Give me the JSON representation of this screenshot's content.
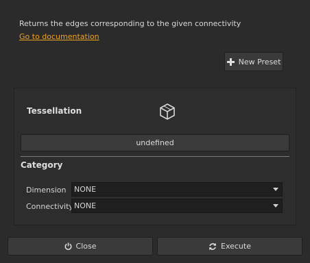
{
  "header": {
    "description": "Returns the edges corresponding to the given connectivity",
    "doc_link": "Go to documentation"
  },
  "toolbar": {
    "new_preset_label": "New Preset",
    "new_preset_icon": "plus-icon"
  },
  "tessellation": {
    "title": "Tessellation",
    "icon": "cube-icon",
    "value_label": "undefined"
  },
  "category": {
    "title": "Category",
    "fields": [
      {
        "label": "Dimension",
        "value": "NONE"
      },
      {
        "label": "Connectivity",
        "value": "NONE"
      }
    ]
  },
  "footer": {
    "close_label": "Close",
    "close_icon": "power-icon",
    "execute_label": "Execute",
    "execute_icon": "refresh-icon"
  },
  "colors": {
    "background": "#2b2b2b",
    "link": "#f0a31c",
    "input_bg": "#1f1f1f"
  }
}
